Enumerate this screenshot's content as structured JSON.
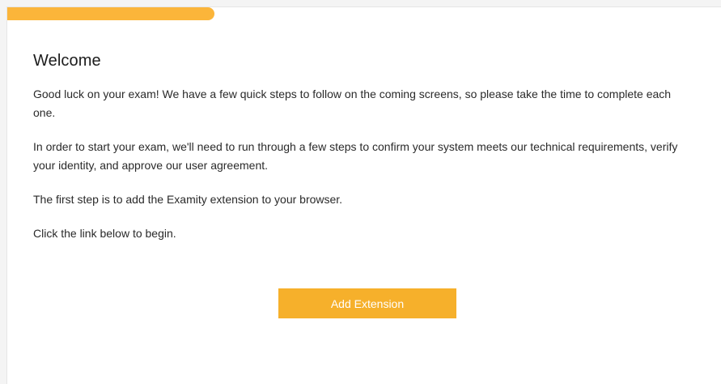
{
  "progress": {
    "fraction": 0.29,
    "color": "#fbb53a"
  },
  "welcome": {
    "title": "Welcome",
    "paragraphs": [
      "Good luck on your exam! We have a few quick steps to follow on the coming screens, so please take the time to complete each one.",
      "In order to start your exam, we'll need to run through a few steps to confirm your system meets our technical requirements, verify your identity, and approve our user agreement.",
      "The first step is to add the Examity extension to your browser.",
      "Click the link below to begin."
    ],
    "button_label": "Add Extension",
    "button_color": "#f6b02b"
  }
}
